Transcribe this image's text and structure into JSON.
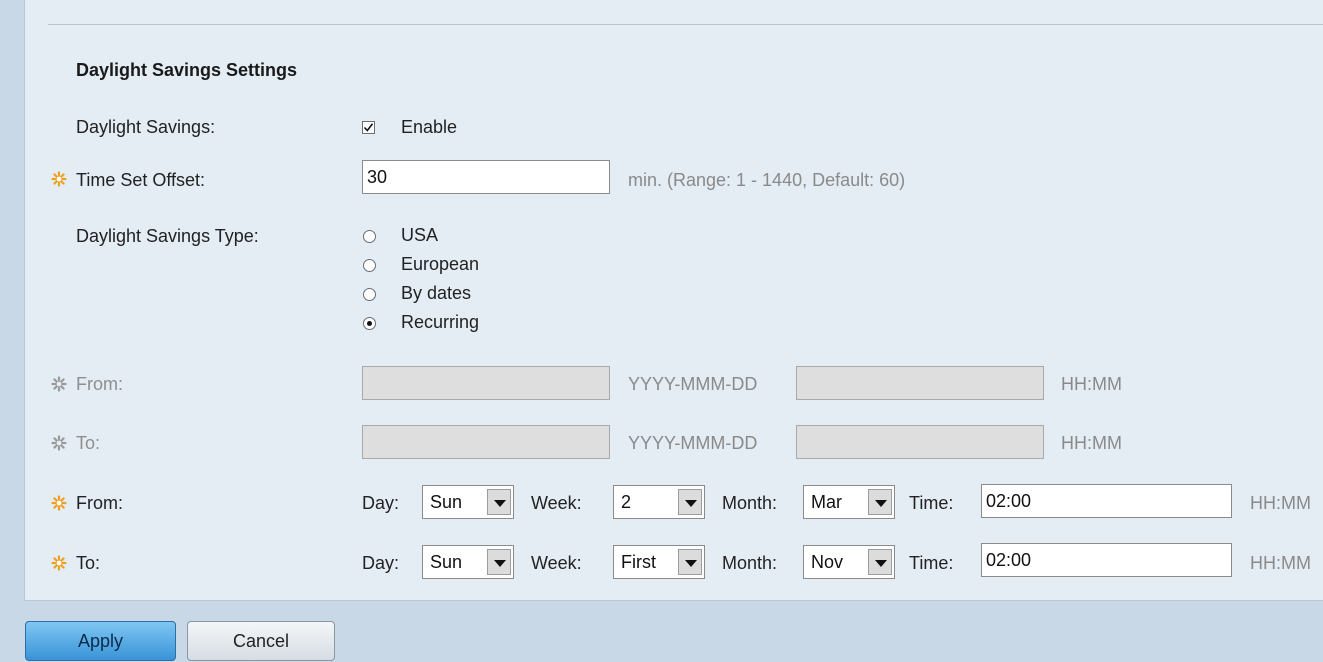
{
  "section_title": "Daylight Savings Settings",
  "daylight_savings": {
    "label": "Daylight Savings:",
    "checkbox_label": "Enable",
    "checked": true
  },
  "time_set_offset": {
    "label": "Time Set Offset:",
    "value": "30",
    "hint": "min. (Range: 1 - 1440, Default: 60)"
  },
  "daylight_savings_type": {
    "label": "Daylight Savings Type:",
    "options": [
      "USA",
      "European",
      "By dates",
      "Recurring"
    ],
    "selected": "Recurring"
  },
  "by_dates": {
    "from_label": "From:",
    "to_label": "To:",
    "date_hint": "YYYY-MMM-DD",
    "time_hint": "HH:MM",
    "from_date": "",
    "from_time": "",
    "to_date": "",
    "to_time": ""
  },
  "recurring": {
    "from_label": "From:",
    "to_label": "To:",
    "day_label": "Day:",
    "week_label": "Week:",
    "month_label": "Month:",
    "time_label": "Time:",
    "time_hint": "HH:MM",
    "from": {
      "day": "Sun",
      "week": "2",
      "month": "Mar",
      "time": "02:00"
    },
    "to": {
      "day": "Sun",
      "week": "First",
      "month": "Nov",
      "time": "02:00"
    }
  },
  "buttons": {
    "apply": "Apply",
    "cancel": "Cancel"
  },
  "colors": {
    "required_star": "#f0a020",
    "disabled_star": "#9a9a9a",
    "apply_blue": "#3a93d8"
  },
  "icons": {
    "required": "gear-star-icon",
    "checkbox": "check-icon",
    "dropdown": "chevron-down-icon"
  }
}
